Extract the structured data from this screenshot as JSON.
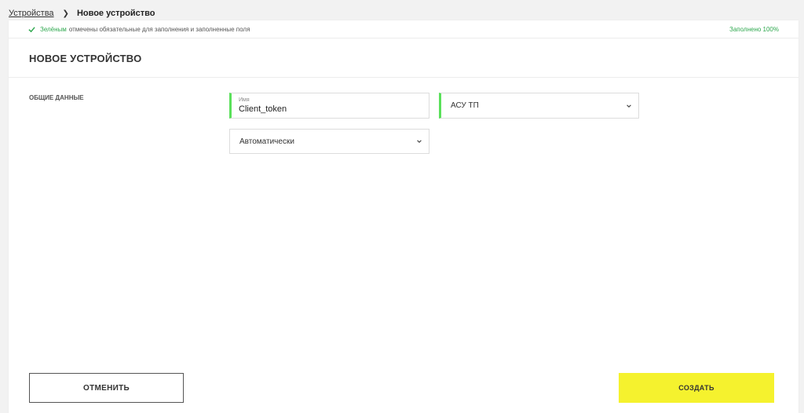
{
  "breadcrumb": {
    "parent": "Устройства",
    "current": "Новое устройство"
  },
  "notice": {
    "green_word": "Зелёным",
    "text": "отмечены обязательные для заполнения и заполненные поля",
    "progress": "Заполнено 100%"
  },
  "page": {
    "title": "НОВОЕ УСТРОЙСТВО"
  },
  "section": {
    "label": "ОБЩИЕ ДАННЫЕ"
  },
  "fields": {
    "name": {
      "label": "Имя",
      "value": "Client_token"
    },
    "type": {
      "value": "АСУ ТП"
    },
    "mode": {
      "value": "Автоматически"
    }
  },
  "actions": {
    "cancel": "ОТМЕНИТЬ",
    "create": "СОЗДАТЬ"
  },
  "colors": {
    "accent_green": "#2fa84f",
    "valid_border": "#5ae05a",
    "create_button": "#f5f22e"
  },
  "icons": {
    "breadcrumb_separator": "chevron-right-icon",
    "notice": "check-icon",
    "select": "chevron-down-icon"
  }
}
